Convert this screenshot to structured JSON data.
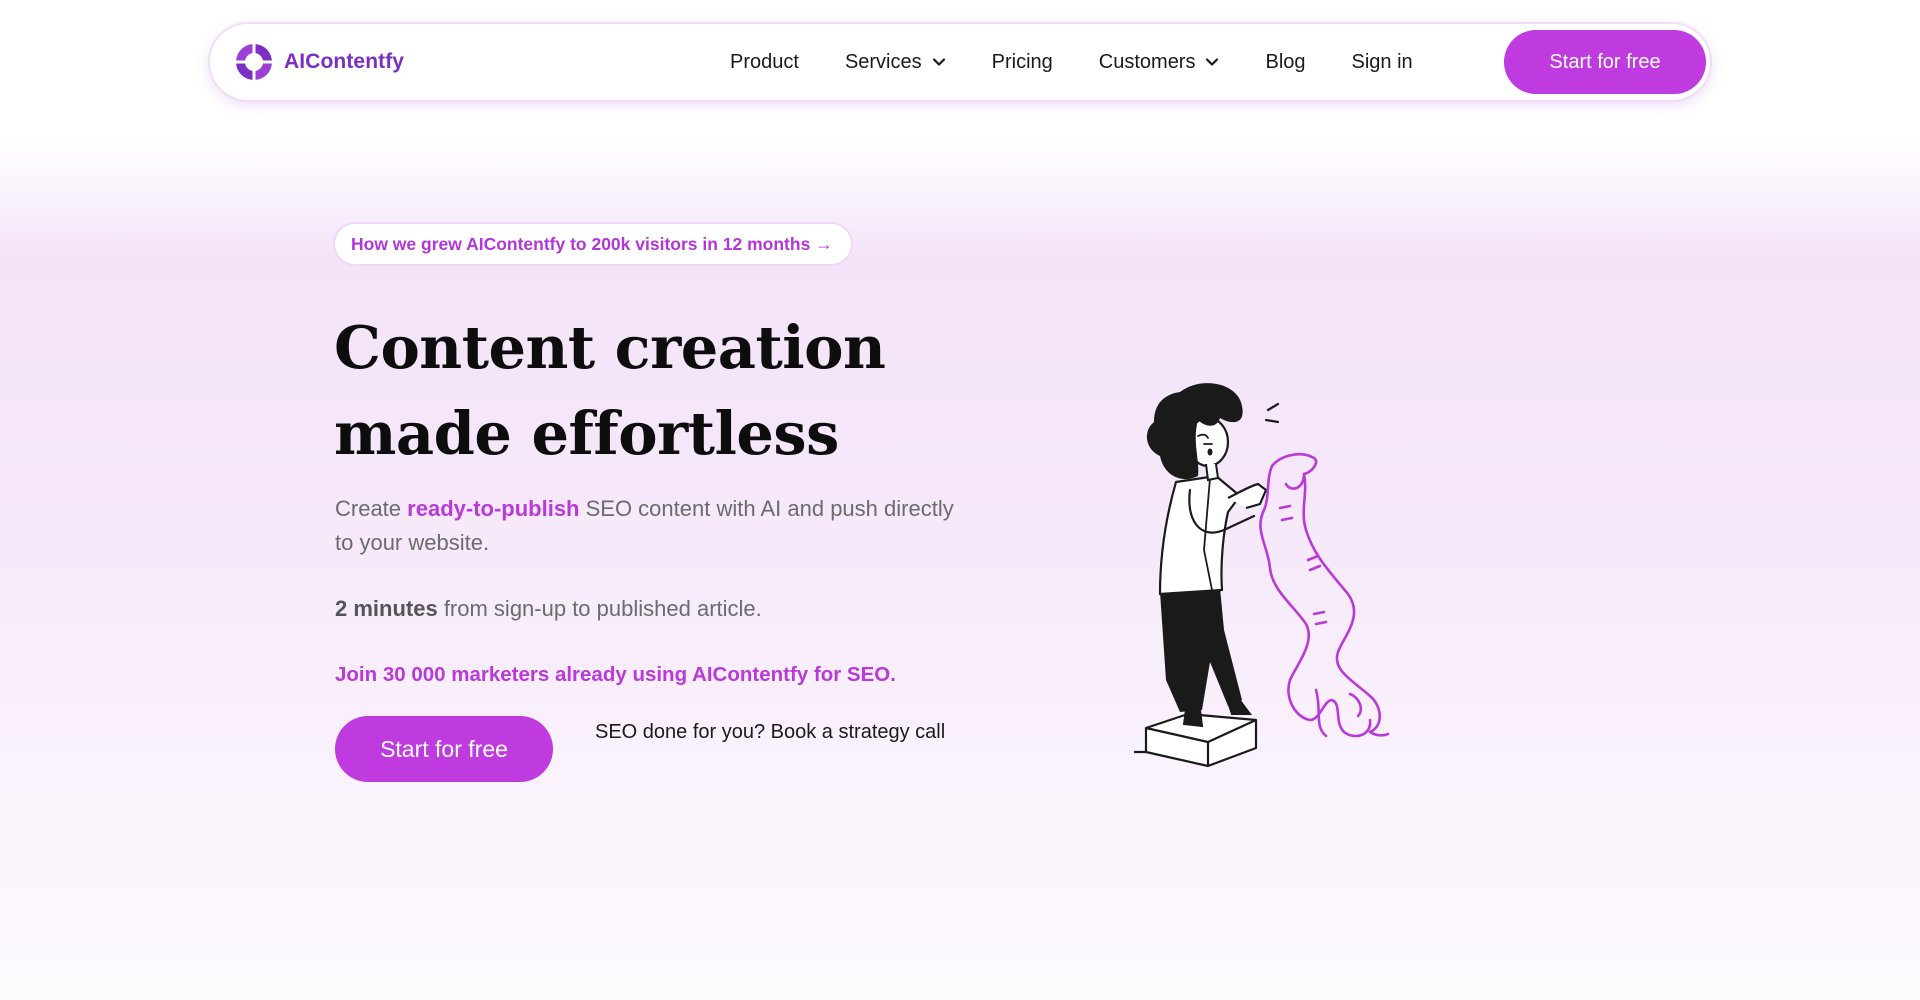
{
  "brand": {
    "name": "AIContentfy",
    "accent_color": "#bf3be0",
    "logo_icon": "aicontentfy-logo-icon"
  },
  "nav": {
    "items": [
      {
        "label": "Product",
        "has_dropdown": false
      },
      {
        "label": "Services",
        "has_dropdown": true
      },
      {
        "label": "Pricing",
        "has_dropdown": false
      },
      {
        "label": "Customers",
        "has_dropdown": true
      },
      {
        "label": "Blog",
        "has_dropdown": false
      },
      {
        "label": "Sign in",
        "has_dropdown": false
      }
    ],
    "cta_label": "Start for free"
  },
  "hero": {
    "announcement": "How we grew AIContentfy to 200k visitors in 12 months →",
    "title": "Content creation made effortless",
    "subtitle_before": "Create ",
    "subtitle_accent": "ready-to-publish",
    "subtitle_after": " SEO content with AI and push directly to your website.",
    "time_strong": "2 minutes",
    "time_rest": " from sign-up to published article.",
    "join_text": "Join 30 000 marketers already using AIContentfy for SEO.",
    "cta_label": "Start for free",
    "secondary_link": "SEO done for you? Book a strategy call"
  },
  "illustration": {
    "icon": "woman-reading-scroll-illustration"
  }
}
